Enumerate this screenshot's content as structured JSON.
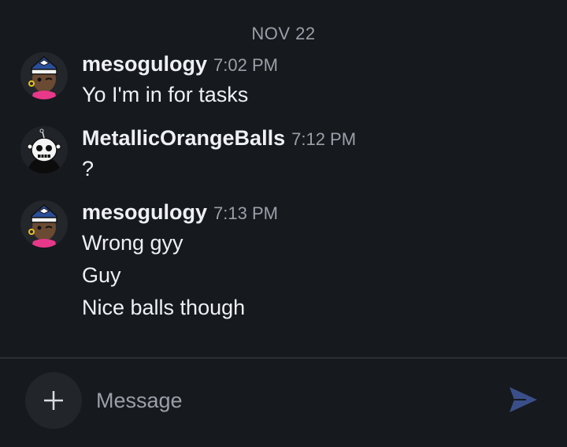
{
  "date_divider": "NOV 22",
  "messages": [
    {
      "username": "mesogulogy",
      "time": "7:02 PM",
      "lines": [
        "Yo I'm in for tasks"
      ],
      "avatar": "captain-avatar-icon"
    },
    {
      "username": "MetallicOrangeBalls",
      "time": "7:12 PM",
      "lines": [
        "?"
      ],
      "avatar": "skull-avatar-icon"
    },
    {
      "username": "mesogulogy",
      "time": "7:13 PM",
      "lines": [
        "Wrong gyy",
        "Guy",
        "Nice balls though"
      ],
      "avatar": "captain-avatar-icon"
    }
  ],
  "composer": {
    "placeholder": "Message",
    "add_icon": "plus-icon",
    "send_icon": "send-icon"
  },
  "colors": {
    "background": "#16191d",
    "text": "#eef0f3",
    "muted": "#9aa0a8",
    "send_accent": "#3a4f8a"
  }
}
